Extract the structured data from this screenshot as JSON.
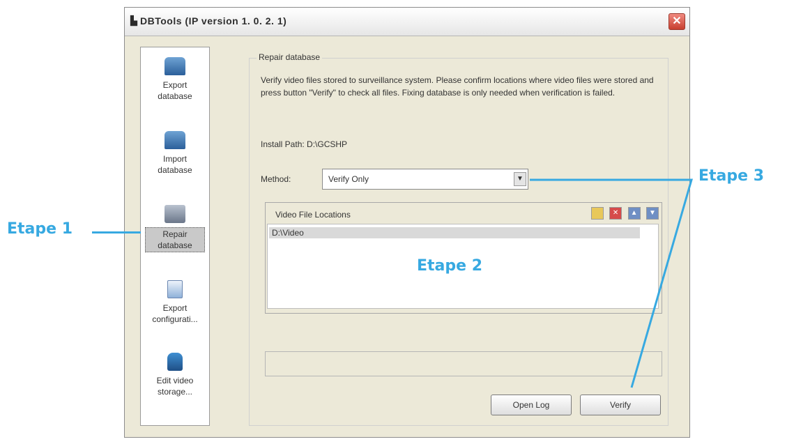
{
  "window": {
    "title": "DBTools (IP version 1. 0. 2. 1)",
    "close_glyph": "✕"
  },
  "sidebar": {
    "items": [
      {
        "label": "Export database",
        "icon": "database-export-icon",
        "selected": false
      },
      {
        "label": "Import database",
        "icon": "database-import-icon",
        "selected": false
      },
      {
        "label": "Repair database",
        "icon": "database-repair-icon",
        "selected": true
      },
      {
        "label": "Export configurati...",
        "icon": "config-export-icon",
        "selected": false
      },
      {
        "label": "Edit video storage...",
        "icon": "video-storage-icon",
        "selected": false
      }
    ]
  },
  "main": {
    "group_title": "Repair database",
    "description": "Verify video files stored to surveillance system. Please confirm locations where video files were stored and press button \"Verify\" to check all files. Fixing database is only needed when verification is failed.",
    "install_path": "Install Path: D:\\GCSHP",
    "method_label": "Method:",
    "method_value": "Verify Only",
    "locations_header": "Video File Locations",
    "locations": [
      "D:\\Video"
    ],
    "open_log_label": "Open Log",
    "verify_label": "Verify"
  },
  "annotations": {
    "step1": "Etape 1",
    "step2": "Etape 2",
    "step3": "Etape 3",
    "color": "#37a9e1"
  }
}
